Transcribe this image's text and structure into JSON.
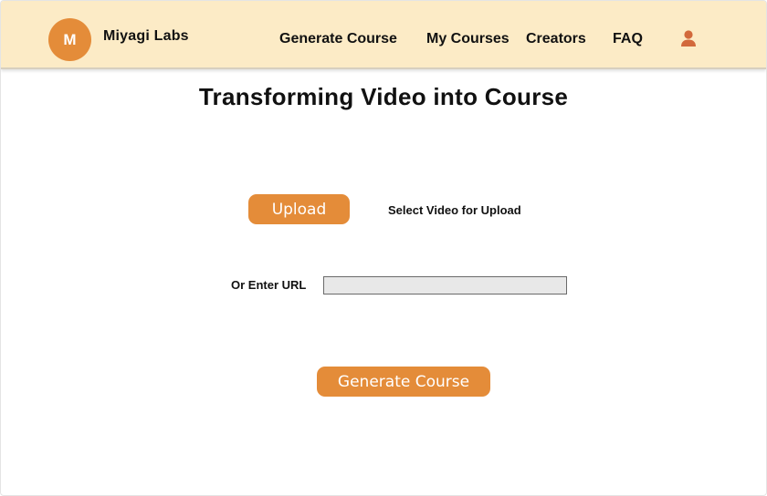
{
  "header": {
    "logo_letter": "M",
    "brand": "Miyagi Labs",
    "nav": [
      {
        "label": "Generate Course"
      },
      {
        "label": "My Courses"
      },
      {
        "label": "Creators"
      },
      {
        "label": "FAQ"
      }
    ],
    "profile_icon": "user-icon"
  },
  "main": {
    "title": "Transforming Video into Course",
    "upload_button": "Upload",
    "upload_hint": "Select Video for Upload",
    "url_label": "Or Enter URL",
    "url_value": "",
    "generate_button": "Generate Course"
  },
  "colors": {
    "header_bg": "#fcebc6",
    "accent": "#e48c39",
    "icon": "#d2693c",
    "input_bg": "#e8e8e8"
  }
}
